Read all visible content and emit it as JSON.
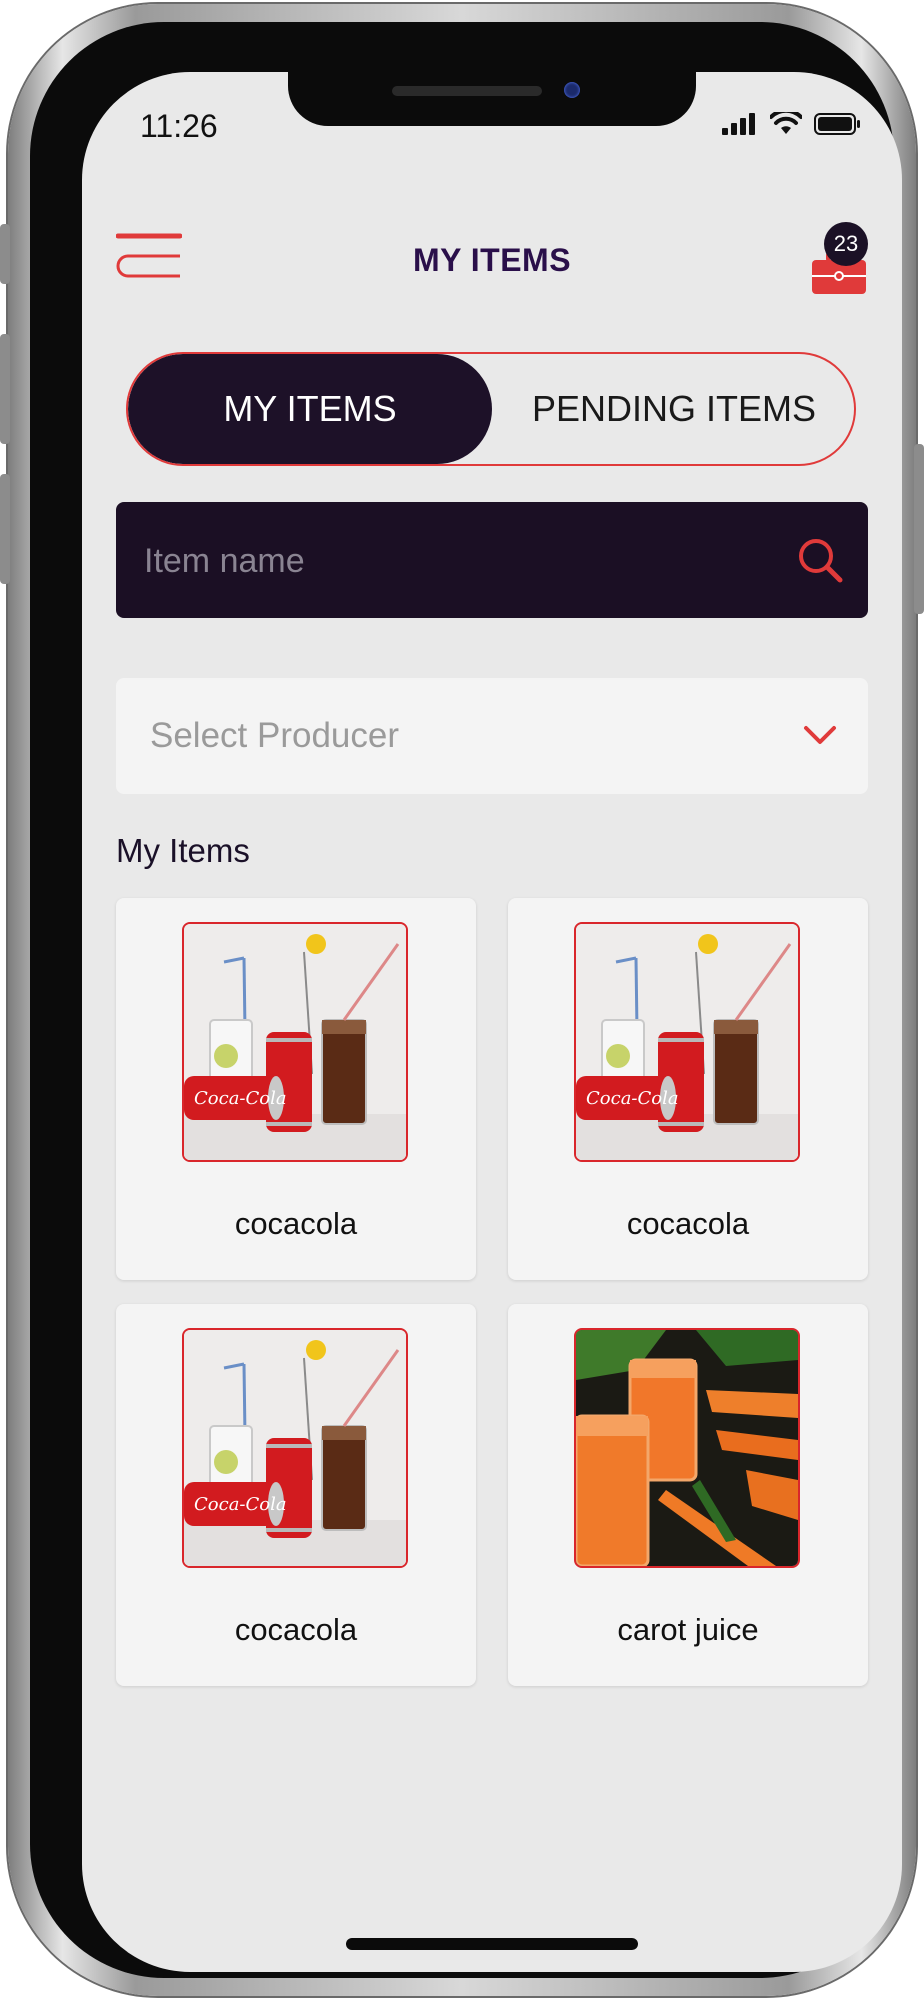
{
  "status_bar": {
    "time": "11:26"
  },
  "header": {
    "title": "MY ITEMS",
    "cart_count": "23"
  },
  "tabs": [
    {
      "label": "MY ITEMS",
      "active": true
    },
    {
      "label": "PENDING ITEMS",
      "active": false
    }
  ],
  "search": {
    "placeholder": "Item name",
    "value": ""
  },
  "producer_select": {
    "placeholder": "Select Producer"
  },
  "section": {
    "title": "My Items"
  },
  "items": [
    {
      "name": "cocacola",
      "image": "cocacola"
    },
    {
      "name": "cocacola",
      "image": "cocacola"
    },
    {
      "name": "cocacola",
      "image": "cocacola"
    },
    {
      "name": "carot juice",
      "image": "carrot-juice"
    }
  ],
  "colors": {
    "accent": "#e03a3a",
    "dark": "#1d1128",
    "title": "#2a0f4a",
    "background": "#e9e9e9",
    "card": "#f4f4f4"
  }
}
